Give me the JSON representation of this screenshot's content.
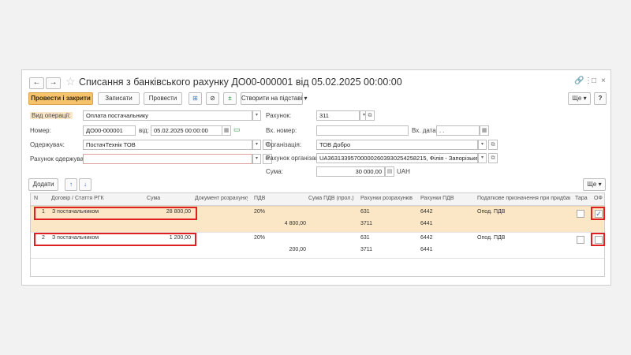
{
  "window": {
    "title": "Списання з банківського рахунку ДО00-000001 від 05.02.2025 00:00:00"
  },
  "nav": {
    "back": "←",
    "forward": "→"
  },
  "window_icons": {
    "link": "🔗",
    "more": "⋮",
    "max": "□",
    "close": "×"
  },
  "toolbar": {
    "post_close": "Провести і закрити",
    "save": "Записати",
    "post": "Провести",
    "create_based": "Створити на підставі",
    "more": "Ще",
    "help": "?"
  },
  "form": {
    "op_type_label": "Вид операції:",
    "op_type_value": "Оплата постачальнику",
    "number_label": "Номер:",
    "number_value": "ДО00-000001",
    "date_label": "від:",
    "date_value": "05.02.2025 00:00:00",
    "recipient_label": "Одержувач:",
    "recipient_value": "ПостачТехнік ТОВ",
    "recipient_account_label": "Рахунок одержувача:",
    "recipient_account_value": "",
    "account_label": "Рахунок:",
    "account_value": "311",
    "in_number_label": "Вх. номер:",
    "in_number_value": "",
    "in_date_label": "Вх. дата:",
    "in_date_value": ". .",
    "org_label": "Організація:",
    "org_value": "ТОВ Добро",
    "org_account_label": "Рахунок організації:",
    "org_account_value": "UA363133957000002603930254258215, Філія - Запорізьке облас",
    "sum_label": "Сума:",
    "sum_value": "30 000,00",
    "currency": "UAH"
  },
  "table_toolbar": {
    "add": "Додати",
    "up": "↑",
    "down": "↓",
    "more": "Ще"
  },
  "table": {
    "headers": [
      "N",
      "Договір / Стаття РГК",
      "Сума",
      "Документ розрахунку",
      "ПДВ",
      "Сума ПДВ (прол.)",
      "Рахунки розрахунків",
      "Рахунки ПДВ",
      "Податкове призначення при придбанні",
      "Тара",
      "ОФ"
    ],
    "rows": [
      {
        "n": "1",
        "contract": "З постачальником",
        "sum": "28 800,00",
        "doc": "",
        "vat": "20%",
        "vat_sum": "4 800,00",
        "acc1": "631",
        "acc2": "3711",
        "vat_acc1": "6442",
        "vat_acc2": "6441",
        "purpose": "Опод. ПДВ",
        "tara": false,
        "of": true
      },
      {
        "n": "2",
        "contract": "З постачальником",
        "sum": "1 200,00",
        "doc": "",
        "vat": "20%",
        "vat_sum": "200,00",
        "acc1": "631",
        "acc2": "3711",
        "vat_acc1": "6442",
        "vat_acc2": "6441",
        "purpose": "Опод. ПДВ",
        "tara": false,
        "of": false
      }
    ]
  },
  "colors": {
    "primary_button": "#f6c26b",
    "selected_row": "#fbe7c6",
    "highlight_box": "#e02020",
    "checkbox_tick": "#2a6fc0"
  }
}
